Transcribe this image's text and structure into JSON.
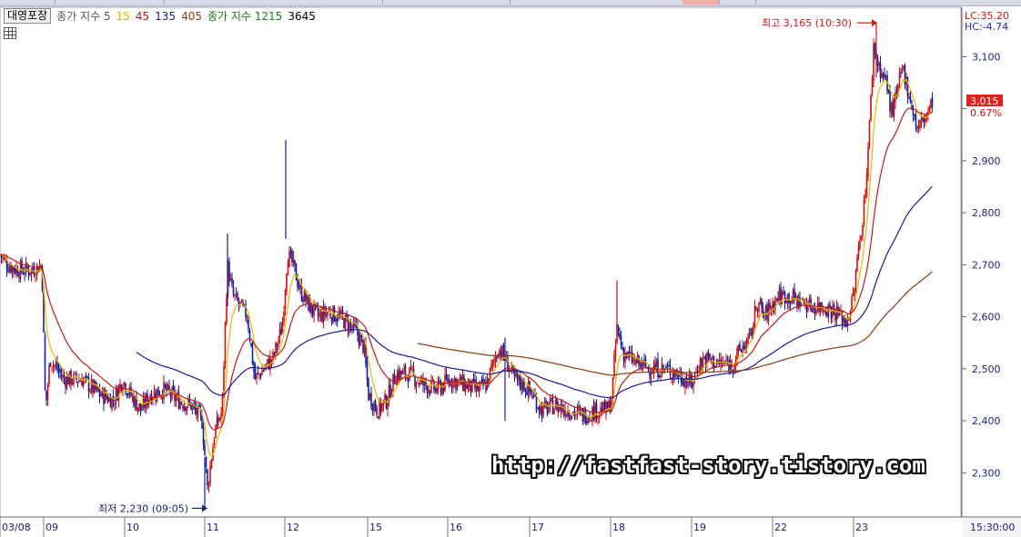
{
  "legend": {
    "stock_name": "대영포장",
    "ma_label": "종가 지수 5",
    "ma_15": "15",
    "ma_45": "45",
    "ma_135": "135",
    "ma_405": "405",
    "ma2_label": "종가 지수 1215",
    "ma_3645": "3645"
  },
  "side": {
    "lc": "LC:35.20",
    "hc": "HC:-4.74",
    "current_price": "3,015",
    "current_change": "0.67%",
    "time": "15:30:00"
  },
  "annotations": {
    "high": "최고 3,165 (10:30)",
    "low": "최저 2,230 (09:05)"
  },
  "watermark": "http://fastfast-story.tistory.com",
  "colors": {
    "ma5": "#e8b800",
    "ma15": "#c81818",
    "ma45": "#1a1a9a",
    "ma135": "#8b3b10",
    "ma1215": "#1a7a1a",
    "candle_up": "#d01010",
    "candle_down": "#1020a0",
    "axis_text": "#1a237e",
    "price_tag": "#e02020"
  },
  "chart_data": {
    "type": "candlestick",
    "y_ticks": [
      2300,
      2400,
      2500,
      2600,
      2700,
      2800,
      2900,
      3000,
      3100
    ],
    "y_tick_labels": [
      "2,300",
      "2,400",
      "2,500",
      "2,600",
      "2,700",
      "2,800",
      "2,900",
      "",
      "3,100"
    ],
    "ylim": [
      2215,
      3195
    ],
    "x_labels": [
      "03/08",
      "09",
      "10",
      "11",
      "12",
      "15",
      "16",
      "17",
      "18",
      "19",
      "22",
      "23"
    ],
    "high": 3165,
    "low": 2230,
    "last": 3015,
    "close_path": [
      [
        0,
        2720
      ],
      [
        8,
        2700
      ],
      [
        20,
        2690
      ],
      [
        35,
        2690
      ],
      [
        46,
        2700
      ],
      [
        50,
        2420
      ],
      [
        55,
        2520
      ],
      [
        70,
        2480
      ],
      [
        90,
        2480
      ],
      [
        110,
        2450
      ],
      [
        125,
        2440
      ],
      [
        135,
        2480
      ],
      [
        140,
        2460
      ],
      [
        155,
        2420
      ],
      [
        165,
        2450
      ],
      [
        180,
        2460
      ],
      [
        195,
        2440
      ],
      [
        210,
        2430
      ],
      [
        222,
        2400
      ],
      [
        228,
        2270
      ],
      [
        236,
        2380
      ],
      [
        244,
        2420
      ],
      [
        250,
        2700
      ],
      [
        256,
        2640
      ],
      [
        264,
        2620
      ],
      [
        272,
        2600
      ],
      [
        280,
        2480
      ],
      [
        290,
        2500
      ],
      [
        300,
        2520
      ],
      [
        310,
        2580
      ],
      [
        316,
        2720
      ],
      [
        322,
        2700
      ],
      [
        330,
        2650
      ],
      [
        340,
        2620
      ],
      [
        350,
        2600
      ],
      [
        360,
        2610
      ],
      [
        372,
        2600
      ],
      [
        380,
        2590
      ],
      [
        392,
        2570
      ],
      [
        400,
        2540
      ],
      [
        405,
        2450
      ],
      [
        415,
        2420
      ],
      [
        425,
        2440
      ],
      [
        435,
        2490
      ],
      [
        450,
        2490
      ],
      [
        465,
        2470
      ],
      [
        480,
        2460
      ],
      [
        495,
        2480
      ],
      [
        510,
        2470
      ],
      [
        525,
        2460
      ],
      [
        535,
        2470
      ],
      [
        540,
        2500
      ],
      [
        548,
        2540
      ],
      [
        555,
        2520
      ],
      [
        565,
        2480
      ],
      [
        575,
        2470
      ],
      [
        585,
        2450
      ],
      [
        595,
        2420
      ],
      [
        610,
        2430
      ],
      [
        625,
        2420
      ],
      [
        640,
        2410
      ],
      [
        655,
        2420
      ],
      [
        668,
        2420
      ],
      [
        672,
        2440
      ],
      [
        678,
        2580
      ],
      [
        685,
        2530
      ],
      [
        700,
        2510
      ],
      [
        715,
        2500
      ],
      [
        730,
        2500
      ],
      [
        745,
        2490
      ],
      [
        760,
        2470
      ],
      [
        768,
        2510
      ],
      [
        775,
        2520
      ],
      [
        790,
        2510
      ],
      [
        805,
        2510
      ],
      [
        815,
        2540
      ],
      [
        825,
        2560
      ],
      [
        832,
        2630
      ],
      [
        840,
        2600
      ],
      [
        855,
        2640
      ],
      [
        865,
        2640
      ],
      [
        878,
        2630
      ],
      [
        892,
        2620
      ],
      [
        905,
        2620
      ],
      [
        918,
        2610
      ],
      [
        930,
        2590
      ],
      [
        937,
        2630
      ],
      [
        943,
        2720
      ],
      [
        950,
        2820
      ],
      [
        955,
        2950
      ],
      [
        960,
        3120
      ],
      [
        966,
        3080
      ],
      [
        974,
        3050
      ],
      [
        980,
        2990
      ],
      [
        986,
        3030
      ],
      [
        992,
        3080
      ],
      [
        1000,
        3020
      ],
      [
        1008,
        2960
      ],
      [
        1015,
        2980
      ],
      [
        1022,
        3000
      ],
      [
        1025,
        3015
      ]
    ]
  }
}
